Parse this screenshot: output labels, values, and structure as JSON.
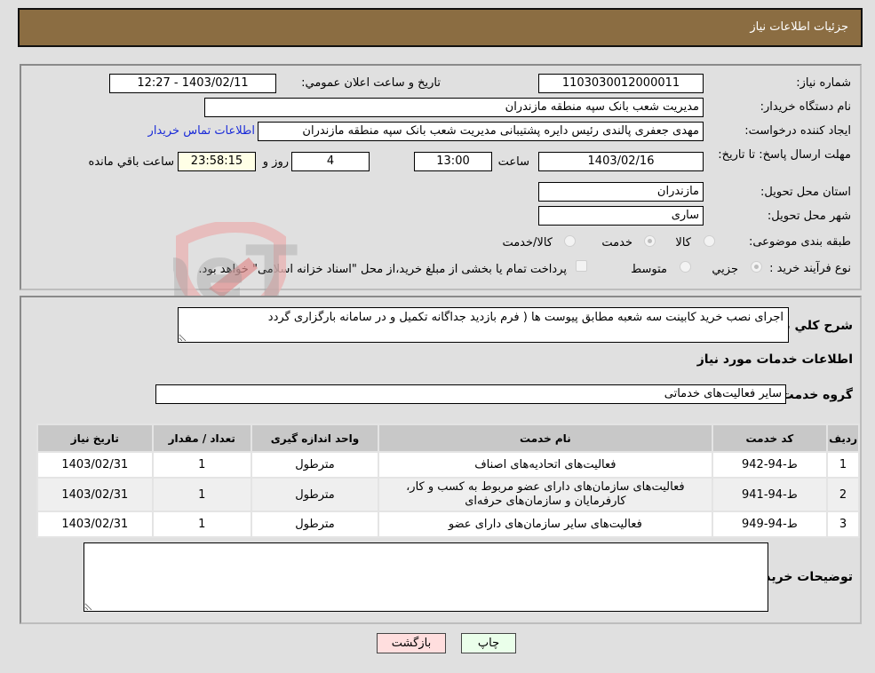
{
  "header": {
    "title": "جزئیات اطلاعات نیاز"
  },
  "details": {
    "need_number_label": "شماره نیاز:",
    "need_number": "1103030012000011",
    "announce_label": "تاریخ و ساعت اعلان عمومي:",
    "announce_value": "1403/02/11 - 12:27",
    "buyer_org_label": "نام دستگاه خریدار:",
    "buyer_org": "مدیریت شعب بانک سپه منطقه مازندران",
    "creator_label": "ایجاد کننده درخواست:",
    "creator": "مهدی جعفری پالندی رئیس دایره پشتیبانی مدیریت شعب بانک سپه منطقه مازندران",
    "contact_link": "اطلاعات تماس خریدار",
    "deadline_label": "مهلت ارسال پاسخ: تا تاریخ:",
    "deadline_date": "1403/02/16",
    "time_label": "ساعت",
    "deadline_time": "13:00",
    "days_value": "4",
    "days_label": "روز و",
    "remaining_time": "23:58:15",
    "remaining_label": "ساعت باقي مانده",
    "province_label": "استان محل تحویل:",
    "province": "مازندران",
    "city_label": "شهر محل تحویل:",
    "city": "ساری",
    "category_label": "طبقه بندی موضوعی:",
    "category_options": [
      {
        "label": "کالا",
        "checked": false
      },
      {
        "label": "خدمت",
        "checked": true
      },
      {
        "label": "کالا/خدمت",
        "checked": false
      }
    ],
    "process_label": "نوع فرآیند خرید :",
    "process_options": [
      {
        "label": "جزيي",
        "checked": true
      },
      {
        "label": "متوسط",
        "checked": false
      }
    ],
    "payment_note": "پرداخت تمام یا بخشی از مبلغ خرید،از محل \"اسناد خزانه اسلامی\" خواهد بود."
  },
  "description": {
    "label": "شرح کلي نیاز:",
    "value": "اجرای نصب خرید کابینت سه شعبه مطابق پیوست ها ( فرم بازدید جداگانه تکمیل و در سامانه بارگزاری گردد"
  },
  "services": {
    "section_title": "اطلاعات خدمات مورد نیاز",
    "group_label": "گروه خدمت:",
    "group_value": "سایر فعالیت‌های خدماتی",
    "columns": [
      "ردیف",
      "کد خدمت",
      "نام خدمت",
      "واحد اندازه گیری",
      "تعداد / مقدار",
      "تاریخ نیاز"
    ],
    "rows": [
      {
        "index": "1",
        "code": "ط-94-942",
        "name": "فعالیت‌های اتحادیه‌های اصناف",
        "unit": "مترطول",
        "qty": "1",
        "date": "1403/02/31"
      },
      {
        "index": "2",
        "code": "ط-94-941",
        "name": "فعالیت‌های سازمان‌های دارای عضو مربوط به کسب و کار، کارفرمایان و سازمان‌های حرفه‌ای",
        "unit": "مترطول",
        "qty": "1",
        "date": "1403/02/31"
      },
      {
        "index": "3",
        "code": "ط-94-949",
        "name": "فعالیت‌های سایر سازمان‌های دارای عضو",
        "unit": "مترطول",
        "qty": "1",
        "date": "1403/02/31"
      }
    ]
  },
  "buyer_notes": {
    "label": "توضیحات خریدار:",
    "value": ""
  },
  "buttons": {
    "print": "چاپ",
    "back": "بازگشت"
  },
  "watermark": {
    "text": "AriaTender.neT"
  },
  "colors": {
    "header_bg": "#8b6d42",
    "print_bg": "#eaffea",
    "back_bg": "#ffdede",
    "link": "#1a2bd8"
  }
}
